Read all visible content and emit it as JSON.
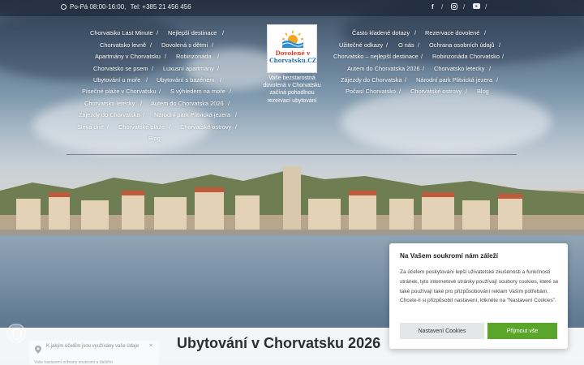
{
  "topbar": {
    "hours": "Po-Pá 08:00-16:00,",
    "phone": "Tel: +385 21 456 456",
    "social_icons": [
      "facebook-icon",
      "instagram-icon",
      "youtube-icon"
    ]
  },
  "nav_left": [
    [
      "Chorvatsko Last Minute",
      "Nejlepší destinace"
    ],
    [
      "Chorvatsko levně",
      "Dovolená s dětmi"
    ],
    [
      "Apartmány v Chorvatsku",
      "Robinzonáda"
    ],
    [
      "Chorvatsko se psem",
      "Luxusní apartmány"
    ],
    [
      "Ubytování u moře",
      "Ubytování s bazénem"
    ],
    [
      "Písečné pláže v Chorvatsku",
      "S výhledem na moře"
    ],
    [
      "Chorvatsko letecky",
      "Autem do Chorvatska 2026"
    ],
    [
      "Zájezdy do Chorvatska",
      "Národní park Plitvická jezera"
    ],
    [
      "Sleva dne",
      "Chorvatské pláže",
      "Chorvatské ostrovy"
    ],
    [
      "Blog"
    ]
  ],
  "nav_right": [
    [
      "Často kladené dotazy",
      "Rezervace dovolené"
    ],
    [
      "Užitečné odkazy",
      "O nás",
      "Ochrana osobních údajů"
    ],
    [
      "Chorvatsko – nejlepší destinace",
      "Robinzonáda Chorvatsko"
    ],
    [
      "Autem do Chorvatska 2026",
      "Chorvatsko letecky"
    ],
    [
      "Zájezdy do Chorvatska",
      "Národní park Plitvická jezera"
    ],
    [
      "Počasí Chorvatsko",
      "Chorvatské ostrovy",
      "Blog"
    ]
  ],
  "logo": {
    "line1": "Dovolené v",
    "line2": "Chorvatsku.CZ",
    "tagline": [
      "Vaše bezstarostná",
      "dovolená v Chorvatsku",
      "začíná pohodlnou",
      "rezervací ubytování"
    ]
  },
  "hero": {
    "title": "Ubytování v Chorvatsku 2026"
  },
  "cookie": {
    "title": "Na Vašem soukromí nám záleží",
    "text": "Za účelem poskytování lepší uživatelské zkušenosti a funkčnosti stránek, tyto internetové stránky používají soubory cookies, které se také používají také pro přizpůsobování reklam Vašim potřebám. Chcete-li si přizpůsobit nastavení, klikněte na \"Nastavení Cookies\".",
    "settings_label": "Nastavení Cookies",
    "accept_label": "Přijmout vše"
  },
  "privacy_widget": {
    "question": "K jakým účelům jsou využívány vaše údaje",
    "close": "×",
    "footer": "Vaše nastavení ochrany soukromí a dalšího"
  },
  "colors": {
    "accent_green": "#5aa52b",
    "logo_red": "#d23b2e",
    "logo_blue": "#1f6fb5"
  }
}
